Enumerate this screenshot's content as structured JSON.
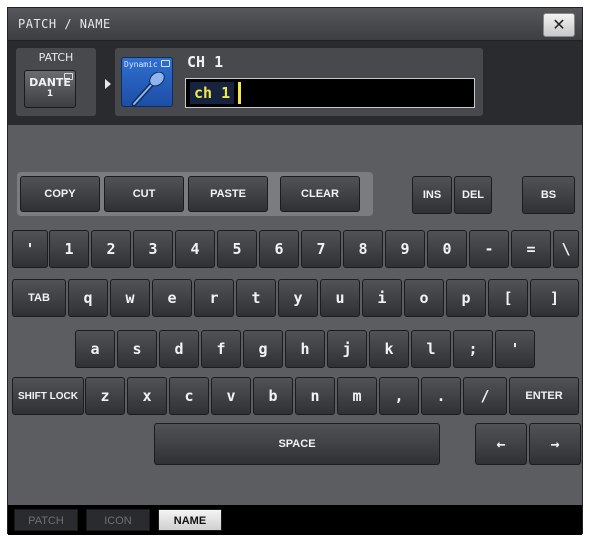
{
  "window": {
    "title": "PATCH / NAME",
    "close_icon": "close-icon"
  },
  "patch": {
    "label": "PATCH",
    "button_line1": "DANTE",
    "button_line2": "1"
  },
  "channel": {
    "icon_label": "Dynamic",
    "icon_name": "dynamic-microphone-icon",
    "title": "CH 1",
    "name_value": "ch 1"
  },
  "edit_keys": {
    "copy": "COPY",
    "cut": "CUT",
    "paste": "PASTE",
    "clear": "CLEAR"
  },
  "edit_right": {
    "ins": "INS",
    "del": "DEL",
    "bs": "BS"
  },
  "keyboard": {
    "row1": [
      "'",
      "1",
      "2",
      "3",
      "4",
      "5",
      "6",
      "7",
      "8",
      "9",
      "0",
      "-",
      "=",
      "\\"
    ],
    "row2_tab": "TAB",
    "row2": [
      "q",
      "w",
      "e",
      "r",
      "t",
      "y",
      "u",
      "i",
      "o",
      "p",
      "[",
      "]"
    ],
    "row3": [
      "a",
      "s",
      "d",
      "f",
      "g",
      "h",
      "j",
      "k",
      "l",
      ";",
      "'"
    ],
    "row4_shift": "SHIFT LOCK",
    "row4": [
      "z",
      "x",
      "c",
      "v",
      "b",
      "n",
      "m",
      ",",
      ".",
      "/"
    ],
    "row4_enter": "ENTER",
    "space": "SPACE",
    "left_arrow": "←",
    "right_arrow": "→"
  },
  "tabs": [
    {
      "label": "PATCH",
      "active": false
    },
    {
      "label": "ICON",
      "active": false
    },
    {
      "label": "NAME",
      "active": true
    }
  ],
  "colors": {
    "window_bg": "#5b5d61",
    "header_bg": "#2a2b2e",
    "name_text": "#f3e64a",
    "icon_bg": "#2f6fd0"
  }
}
